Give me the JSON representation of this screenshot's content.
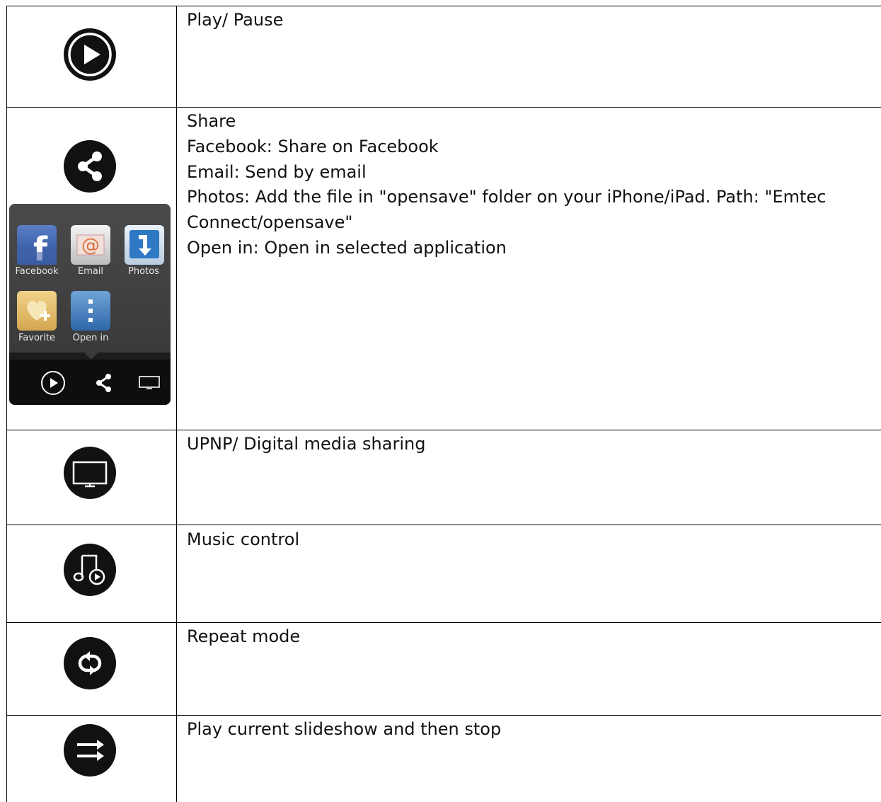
{
  "rows": [
    {
      "icon": "play-icon",
      "lines": [
        "Play/ Pause"
      ]
    },
    {
      "icon": "share-icon",
      "lines": [
        "Share",
        "Facebook: Share on Facebook",
        "Email: Send by email",
        "Photos: Add the file in \"opensave\" folder on your iPhone/iPad.  Path: \"Emtec",
        "Connect/opensave\"",
        "Open in: Open in selected application"
      ]
    },
    {
      "icon": "tv-icon",
      "lines": [
        "UPNP/ Digital media sharing"
      ]
    },
    {
      "icon": "music-icon",
      "lines": [
        "Music control"
      ]
    },
    {
      "icon": "repeat-icon",
      "lines": [
        "Repeat mode"
      ]
    },
    {
      "icon": "slideshow-stop-icon",
      "lines": [
        "Play current slideshow and then stop"
      ]
    }
  ],
  "share_menu": {
    "apps": [
      {
        "label": "Facebook",
        "icon": "facebook-icon"
      },
      {
        "label": "Email",
        "icon": "email-icon"
      },
      {
        "label": "Photos",
        "icon": "photos-icon"
      },
      {
        "label": "Favorite",
        "icon": "favorite-icon"
      },
      {
        "label": "Open in",
        "icon": "open-in-icon"
      }
    ],
    "toolbar": [
      "play-icon",
      "share-icon",
      "tv-icon"
    ]
  }
}
